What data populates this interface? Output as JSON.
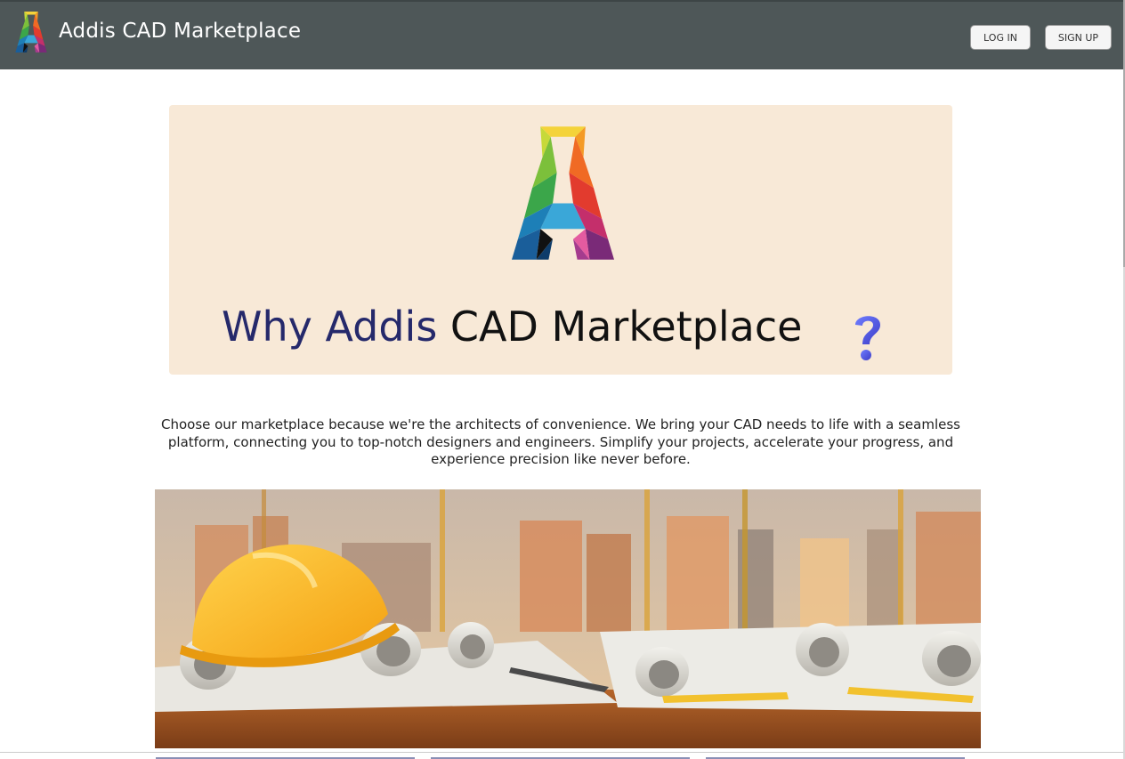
{
  "header": {
    "brand": "Addis CAD Marketplace",
    "login_label": "LOG IN",
    "signup_label": "SIGN UP",
    "bg_color": "#4e5758"
  },
  "hero": {
    "heading_part1": "Why Addis",
    "heading_part2": "CAD Marketplace",
    "bg_color": "#f8e9d7",
    "accent_color": "#25296b"
  },
  "intro": {
    "text": "Choose our marketplace because we're the architects of convenience. We bring your CAD needs to life with a seamless platform, connecting you to top-notch designers and engineers. Simplify your projects, accelerate your progress, and experience precision like never before."
  },
  "icons": {
    "brand": "addis-a-logo-icon",
    "question": "question-mark-icon"
  }
}
